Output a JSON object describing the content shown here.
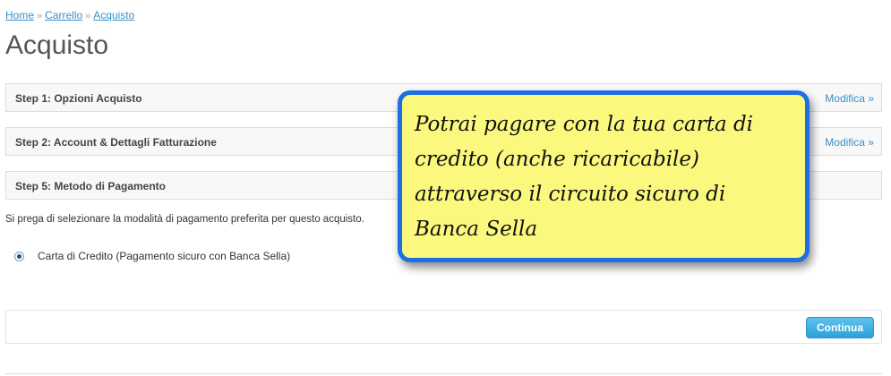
{
  "breadcrumb": {
    "items": [
      "Home",
      "Carrello",
      "Acquisto"
    ],
    "separator": "»"
  },
  "page": {
    "title": "Acquisto"
  },
  "steps": [
    {
      "title": "Step 1: Opzioni Acquisto",
      "edit_label": "Modifica »"
    },
    {
      "title": "Step 2: Account & Dettagli Fatturazione",
      "edit_label": "Modifica »"
    },
    {
      "title": "Step 5: Metodo di Pagamento"
    }
  ],
  "payment": {
    "prompt": "Si prega di selezionare la modalità di pagamento preferita per questo acquisto.",
    "option_label": "Carta di Credito (Pagamento sicuro con Banca Sella)",
    "option_selected": true
  },
  "footer": {
    "continue_label": "Continua"
  },
  "callout": {
    "text": "Potrai pagare con la tua carta di credito (anche ricaricabile) attraverso il circuito sicuro di Banca Sella"
  },
  "colors": {
    "link": "#3a8fc8",
    "callout_bg": "#fbf87e",
    "callout_border": "#1e6fe6",
    "button": "#2ba2d9"
  },
  "icons": {
    "radio": "radio-selected-icon"
  }
}
